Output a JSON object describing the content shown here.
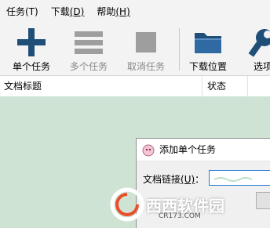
{
  "menu": {
    "task": {
      "label": "任务",
      "accel": "(T)"
    },
    "download": {
      "label": "下载",
      "accel": "(D)"
    },
    "help": {
      "label": "帮助",
      "accel": "(H)"
    }
  },
  "toolbar": {
    "single_task": "单个任务",
    "multi_task": "多个任务",
    "cancel_task": "取消任务",
    "download_location": "下载位置",
    "options": "选项"
  },
  "list": {
    "col_title": "文档标题",
    "col_status": "状态"
  },
  "dialog": {
    "title": "添加单个任务",
    "link_label": "文档链接",
    "link_accel": "(U)",
    "link_colon": "："
  },
  "watermark": {
    "brand": "西西软件园",
    "url": "CR173.COM"
  },
  "colors": {
    "list_background": "#cfe3d5",
    "plus_icon": "#1f4e79",
    "folder_icon": "#1f4e79",
    "disabled_icon": "#9e9e9e"
  },
  "icons": {
    "single_task": "plus-icon",
    "multi_task": "list-icon",
    "cancel_task": "stop-icon",
    "download_location": "folder-icon",
    "options": "wrench-icon"
  }
}
